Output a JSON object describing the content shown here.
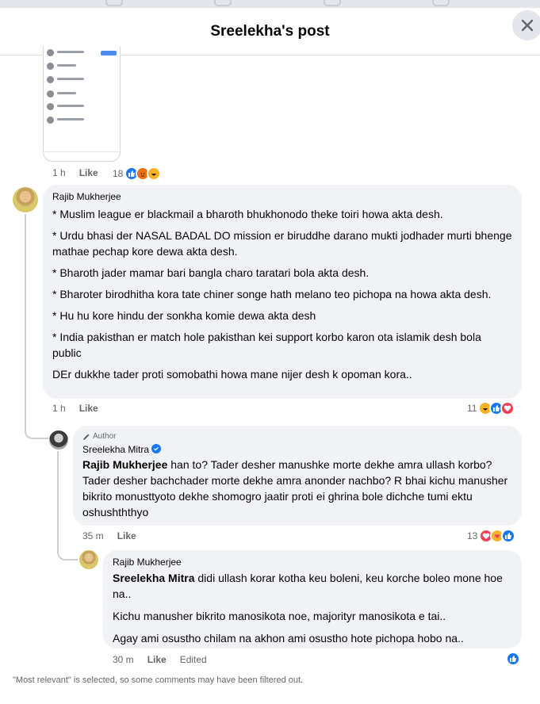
{
  "header": {
    "title": "Sreelekha's post",
    "close_icon": "close-icon"
  },
  "prev_comment": {
    "time": "1 h",
    "like_label": "Like",
    "reaction_count": "18",
    "reaction_icons": [
      "like-icon",
      "angry-icon",
      "haha-icon"
    ]
  },
  "comment1": {
    "author": "Rajib Mukherjee",
    "paragraphs": [
      "* Muslim league er blackmail a bharoth bhukhonodo theke toiri howa akta desh.",
      "* Urdu bhasi der NASAL BADAL DO mission er biruddhe darano mukti jodhader murti bhenge mathae pechap kore dewa akta desh.",
      "* Bharoth jader mamar bari bangla charo taratari bola akta desh.",
      "* Bharoter birodhitha kora tate chiner songe hath melano teo pichopa na howa akta desh.",
      "* Hu hu kore hindu der sonkha komie dewa akta desh",
      "* India pakisthan er match hole pakisthan kei support korbo karon ota islamik desh bola public",
      "DEr dukkhe tader proti somobathi howa mane nijer desh k opoman kora.."
    ],
    "time": "1 h",
    "like_label": "Like",
    "reaction_count": "11",
    "reaction_icons": [
      "haha-icon",
      "like-icon",
      "love-icon"
    ]
  },
  "reply1": {
    "badge": "Author",
    "author": "Sreelekha Mitra",
    "mention": "Rajib Mukherjee",
    "text": "han to? Tader desher manushke morte dekhe amra ullash korbo? Tader desher bachchader morte dekhe amra anonder nachbo? R bhai kichu manusher bikrito monusttyoto dekhe shomogro jaatir proti ei ghrina bole dichche tumi ektu oshushththyo",
    "time": "35 m",
    "like_label": "Like",
    "reaction_count": "13",
    "reaction_icons": [
      "love-icon",
      "care-icon",
      "like-icon"
    ]
  },
  "reply2": {
    "author": "Rajib Mukherjee",
    "mention": "Sreelekha Mitra",
    "first_text": "didi ullash korar kotha keu boleni, keu korche boleo mone hoe na..",
    "paragraphs": [
      "Kichu manusher bikrito manosikota noe, majorityr manosikota e tai..",
      "Agay ami osustho chilam na akhon ami osustho hote pichopa hobo na.."
    ],
    "time": "30 m",
    "like_label": "Like",
    "edited_label": "Edited",
    "reaction_icons": [
      "like-icon"
    ]
  },
  "footer_note": "\"Most relevant\" is selected, so some comments may have been filtered out.",
  "colors": {
    "accent": "#1877f2",
    "bubble": "#f0f2f5",
    "muted": "#65676b",
    "love": "#f33e58",
    "haha": "#f7b125"
  }
}
